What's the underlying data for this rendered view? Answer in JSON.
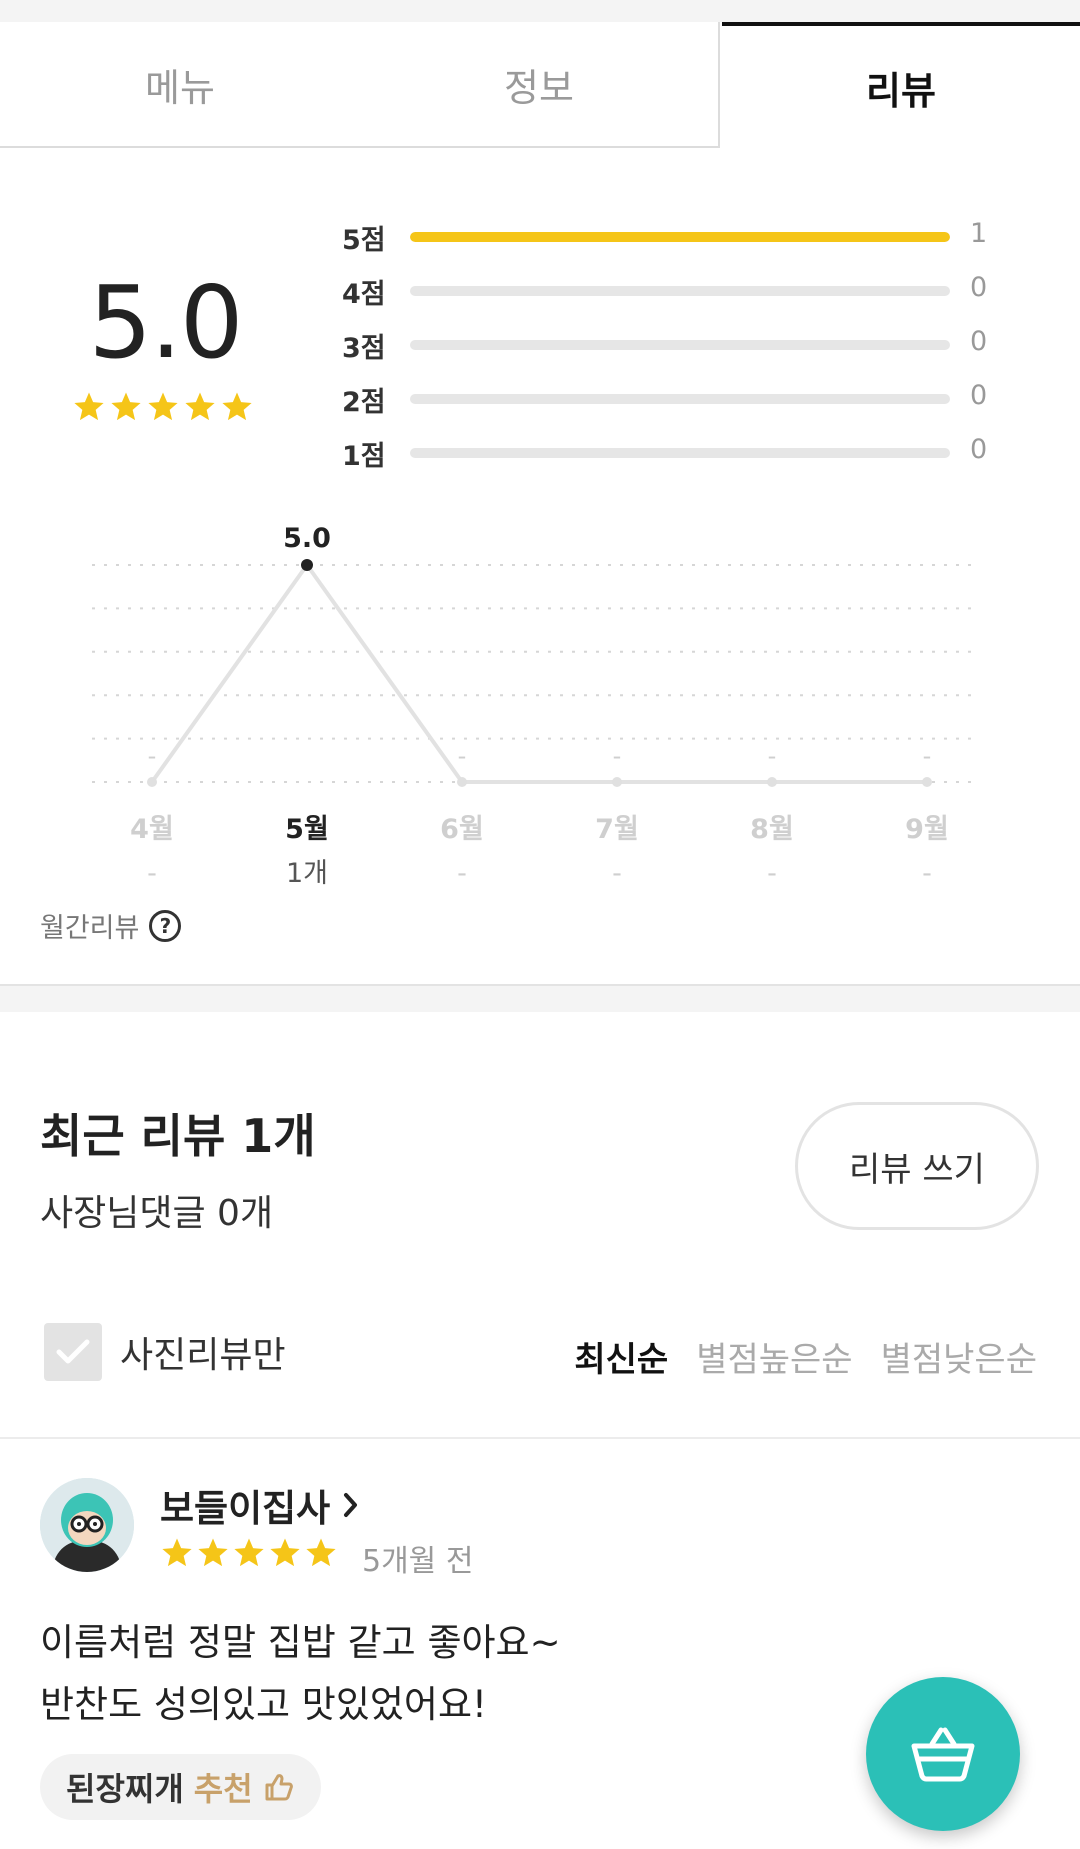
{
  "tabs": [
    {
      "label": "메뉴"
    },
    {
      "label": "정보"
    },
    {
      "label": "리뷰"
    }
  ],
  "summary": {
    "average": "5.0",
    "average_rating": 5,
    "distribution": [
      {
        "label": "5점",
        "count": "1",
        "fraction": 1.0
      },
      {
        "label": "4점",
        "count": "0",
        "fraction": 0
      },
      {
        "label": "3점",
        "count": "0",
        "fraction": 0
      },
      {
        "label": "2점",
        "count": "0",
        "fraction": 0
      },
      {
        "label": "1점",
        "count": "0",
        "fraction": 0
      }
    ]
  },
  "chart_data": {
    "type": "line",
    "categories": [
      "4월",
      "5월",
      "6월",
      "7월",
      "8월",
      "9월"
    ],
    "values": [
      null,
      5.0,
      null,
      null,
      null,
      null
    ],
    "value_labels": [
      "-",
      "5.0",
      "-",
      "-",
      "-",
      "-"
    ],
    "counts": [
      "-",
      "1개",
      "-",
      "-",
      "-",
      "-"
    ],
    "highlight_index": 1,
    "ylim": [
      0,
      5
    ],
    "grid": true
  },
  "monthly_label": "월간리뷰",
  "recent": {
    "title": "최근 리뷰 1개",
    "owner_replies": "사장님댓글 0개",
    "write_button": "리뷰 쓰기"
  },
  "filter": {
    "photo_only_label": "사진리뷰만",
    "sort_options": [
      {
        "label": "최신순",
        "active": true
      },
      {
        "label": "별점높은순",
        "active": false
      },
      {
        "label": "별점낮은순",
        "active": false
      }
    ]
  },
  "review": {
    "author": "보들이집사",
    "rating": 5,
    "time": "5개월 전",
    "text": "이름처럼 정말 집밥 같고 좋아요~\n반찬도 성의있고 맛있었어요!",
    "recommendation": {
      "dish": "된장찌개",
      "label": "추천"
    }
  },
  "colors": {
    "star": "#f5c518",
    "accent": "#2bc0b7",
    "recommend": "#c8a16a"
  }
}
